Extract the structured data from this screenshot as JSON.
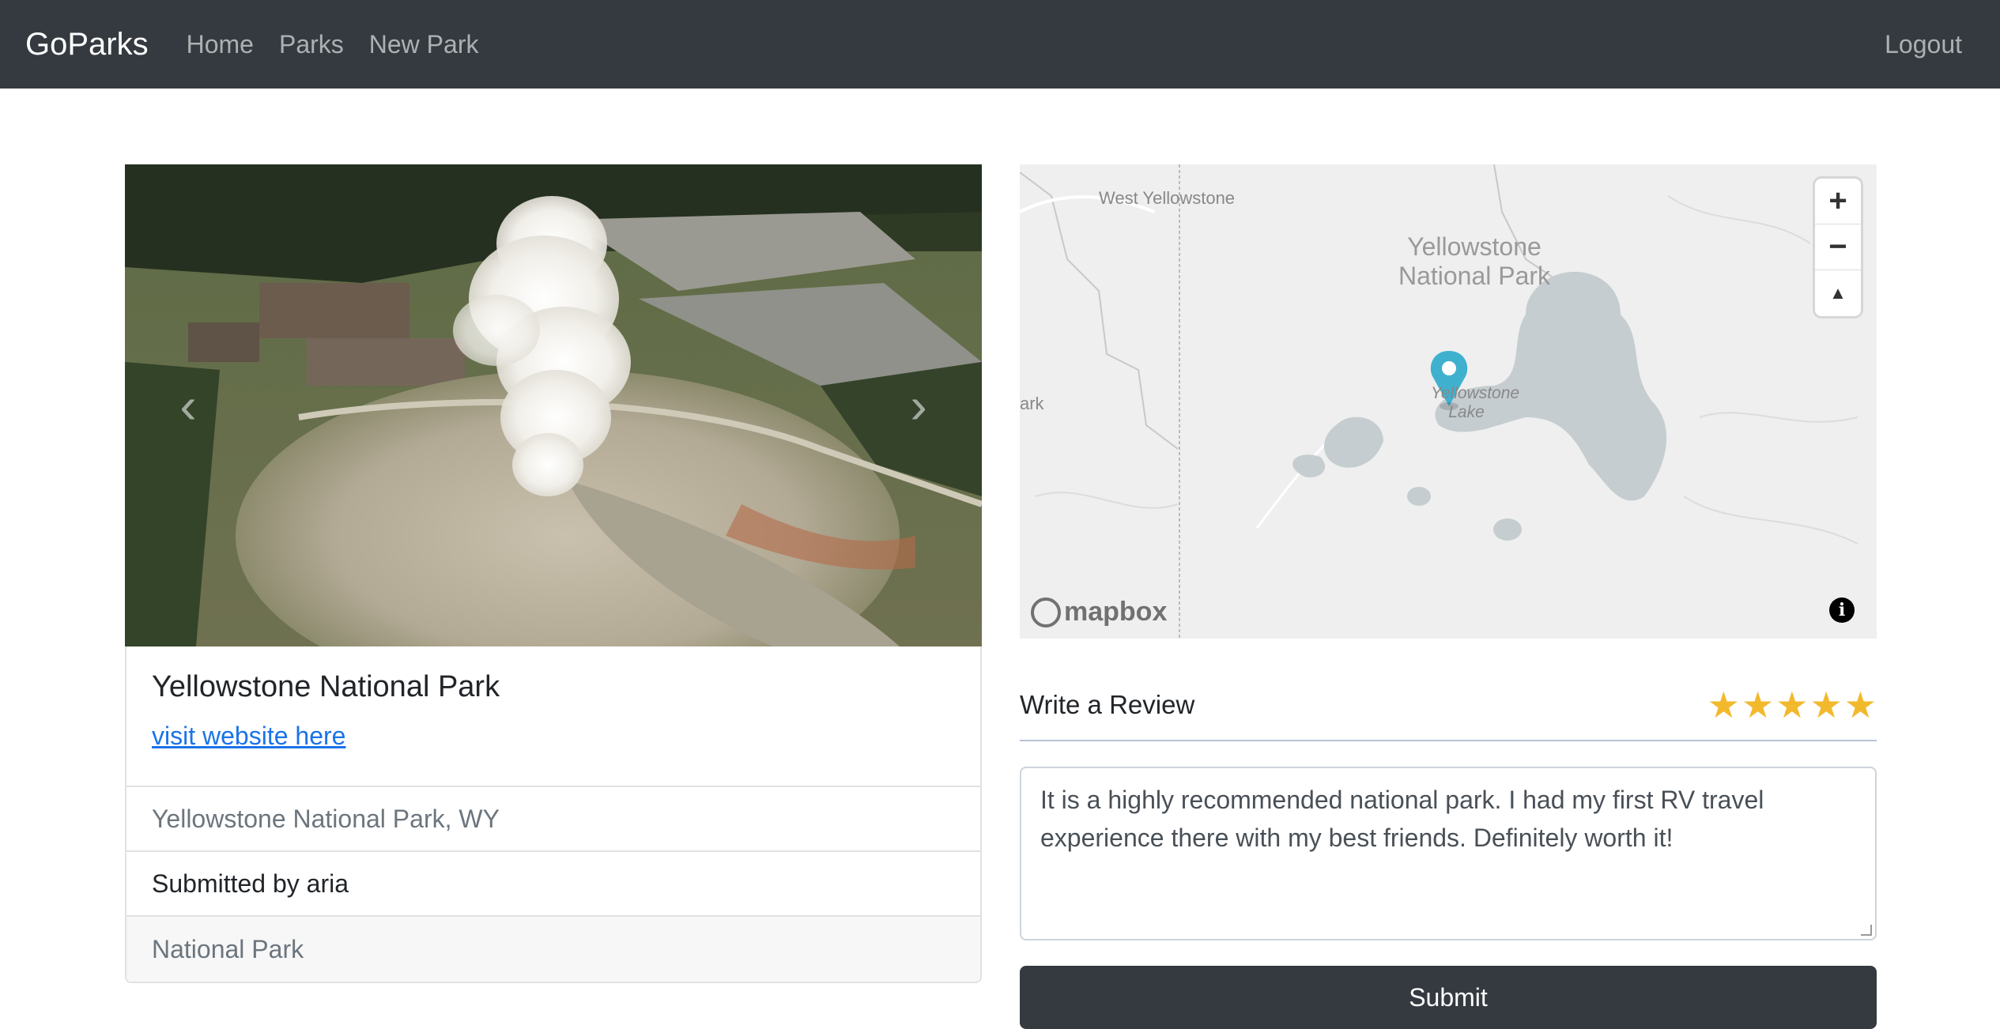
{
  "navbar": {
    "brand": "GoParks",
    "links": [
      "Home",
      "Parks",
      "New Park"
    ],
    "logout": "Logout"
  },
  "carousel": {
    "prev_icon": "chevron-left-icon",
    "next_icon": "chevron-right-icon"
  },
  "park": {
    "title": "Yellowstone National Park",
    "website_link": "visit website here",
    "location": "Yellowstone National Park, WY",
    "submitted_by": "Submitted by aria",
    "category": "National Park"
  },
  "map": {
    "labels": {
      "west_yellowstone": "West Yellowstone",
      "park_name": "Yellowstone National Park",
      "lake": "Yellowstone Lake",
      "edge": "ark"
    },
    "zoom_in": "+",
    "zoom_out": "−",
    "compass": "▲",
    "attribution": "mapbox",
    "info": "i"
  },
  "review": {
    "heading": "Write a Review",
    "rating": 5,
    "stars": [
      "★",
      "★",
      "★",
      "★",
      "★"
    ],
    "text": "It is a highly recommended national park. I had my first RV travel experience there with my best friends. Definitely worth it!",
    "submit": "Submit"
  },
  "colors": {
    "navbar": "#343a40",
    "star": "#f2b92d",
    "link": "#1a73e8",
    "marker": "#3fb1ce"
  }
}
